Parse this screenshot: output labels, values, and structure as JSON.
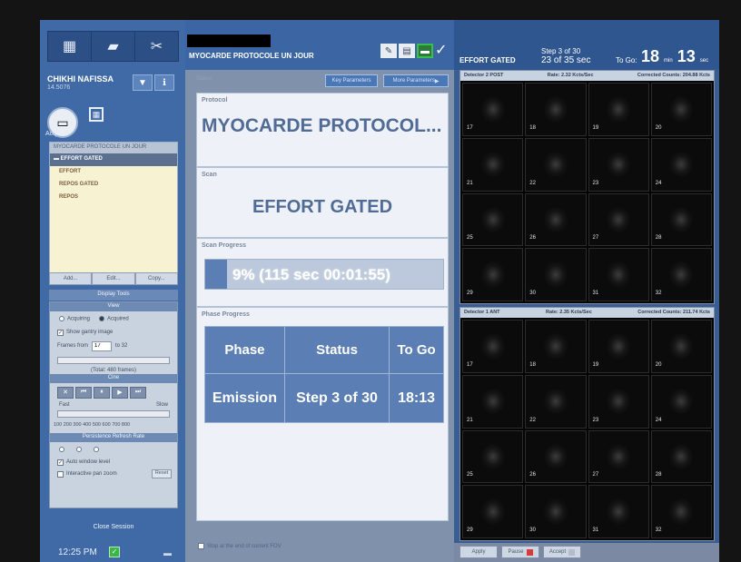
{
  "patient": {
    "name": "CHIKHI NAFISSA",
    "id": "14.5076"
  },
  "left_panel": {
    "acquire_label": "Acquire",
    "protocol_list_title": "MYOCARDE PROTOCOLE UN JOUR",
    "protocol_items": [
      "EFFORT GATED",
      "EFFORT",
      "REPOS GATED",
      "REPOS"
    ],
    "list_buttons": [
      "Add...",
      "Edit...",
      "Copy..."
    ],
    "display_tools": "Display Tools",
    "view_title": "View",
    "view_options": [
      "Acquiring",
      "Acquired"
    ],
    "show_gantry": "Show gantry image",
    "frames_from_label": "Frames from",
    "frames_from_value": "17",
    "frames_to_label": "to 32",
    "total_frames": "(Total: 480 frames)",
    "cine_title": "Cine",
    "fast_label": "Fast",
    "slow_label": "Slow",
    "speed_ticks": "100 200 300 400 500 600 700 800",
    "persistence_title": "Persistence Refresh Rate",
    "auto_window": "Auto window level",
    "interactive_pan": "Interactive pan zoom",
    "reset_label": "Reset",
    "close_session": "Close Session",
    "clock": "12:25 PM"
  },
  "center": {
    "protocol_title": "MYOCARDE PROTOCOLE UN JOUR",
    "status_label": "Status",
    "key_params": "Key Parameters",
    "more_params": "More Parameters",
    "protocol_label": "Protocol",
    "protocol_value": "MYOCARDE PROTOCOL...",
    "scan_label": "Scan",
    "scan_value": "EFFORT GATED",
    "scan_progress_label": "Scan Progress",
    "scan_progress_text": "9% (115 sec   00:01:55)",
    "scan_progress_fraction": 0.09,
    "phase_progress_label": "Phase Progress",
    "phase_headers": [
      "Phase",
      "Status",
      "To Go"
    ],
    "phase_row": [
      "Emission",
      "Step 3 of 30",
      "18:13"
    ],
    "stop_label": "Stop at the end of current FOV"
  },
  "right": {
    "scan_name": "EFFORT GATED",
    "step_line1": "Step 3 of 30",
    "step_line2": "23 of 35 sec",
    "togo_label": "To Go:",
    "togo_min": "18",
    "togo_min_unit": "min",
    "togo_sec": "13",
    "togo_sec_unit": "sec",
    "detector2": {
      "name": "Detector 2  POST",
      "rate": "Rate: 2.32 Kcts/Sec",
      "counts": "Corrected Counts: 204.88 Kcts"
    },
    "detector1": {
      "name": "Detector 1  ANT",
      "rate": "Rate: 2.35 Kcts/Sec",
      "counts": "Corrected Counts: 211.74 Kcts"
    },
    "frames": [
      "17",
      "18",
      "19",
      "20",
      "21",
      "22",
      "23",
      "24",
      "25",
      "26",
      "27",
      "28",
      "29",
      "30",
      "31",
      "32"
    ],
    "bottom_buttons": [
      "Apply",
      "Pause",
      "Accept"
    ]
  }
}
